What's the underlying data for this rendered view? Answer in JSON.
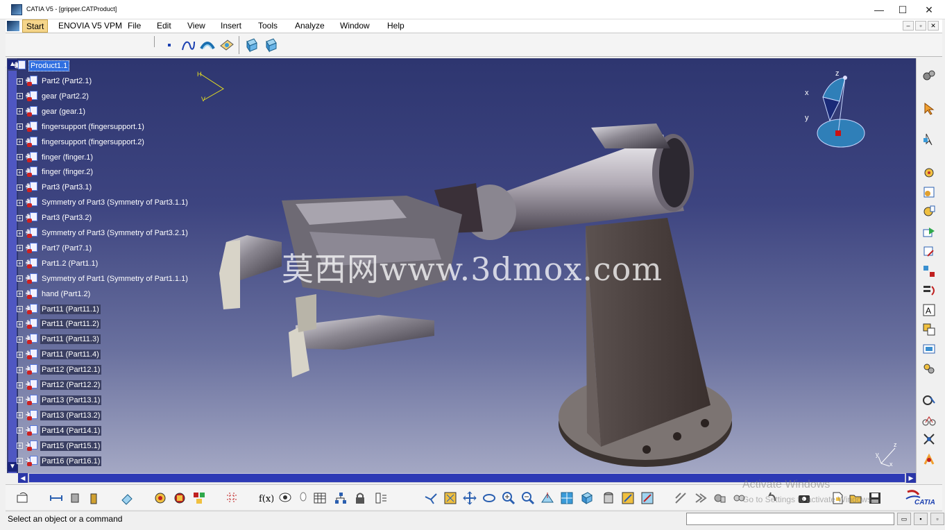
{
  "window": {
    "title": "CATIA V5 - [gripper.CATProduct]",
    "controls": {
      "minimize": "—",
      "maximize": "☐",
      "close": "✕"
    }
  },
  "menu": {
    "items": [
      "Start",
      "ENOVIA V5 VPM",
      "File",
      "Edit",
      "View",
      "Insert",
      "Tools",
      "Analyze",
      "Window",
      "Help"
    ],
    "mdi_controls": [
      "–",
      "▫",
      "✕"
    ]
  },
  "tree": {
    "root": "Product1.1",
    "items": [
      "Part2 (Part2.1)",
      "gear (Part2.2)",
      "gear (gear.1)",
      "fingersupport (fingersupport.1)",
      "fingersupport (fingersupport.2)",
      "finger (finger.1)",
      "finger (finger.2)",
      "Part3 (Part3.1)",
      "Symmetry of Part3 (Symmetry of Part3.1.1)",
      "Part3 (Part3.2)",
      "Symmetry of Part3 (Symmetry of Part3.2.1)",
      "Part7 (Part7.1)",
      "Part1.2 (Part1.1)",
      "Symmetry of Part1 (Symmetry of Part1.1.1)",
      "hand (Part1.2)",
      "Part11 (Part11.1)",
      "Part11 (Part11.2)",
      "Part11 (Part11.3)",
      "Part11 (Part11.4)",
      "Part12 (Part12.1)",
      "Part12 (Part12.2)",
      "Part13 (Part13.1)",
      "Part13 (Part13.2)",
      "Part14 (Part14.1)",
      "Part15 (Part15.1)",
      "Part16 (Part16.1)"
    ]
  },
  "viewport": {
    "watermark": "莫西网www.3dmox.com",
    "compass": {
      "x": "x",
      "y": "y",
      "z": "z"
    },
    "axis_labels": {
      "h": "H",
      "v": "V",
      "x": "x",
      "y": "y",
      "z": "z"
    }
  },
  "os_notice": {
    "title": "Activate Windows",
    "subtitle": "Go to Settings to activate Windows."
  },
  "status": {
    "message": "Select an object or a command",
    "command_value": ""
  },
  "brand": {
    "logo_text": "CATIA"
  },
  "colors": {
    "viewport_top": "#2e3670",
    "viewport_bottom": "#a4a8c4",
    "selection": "#2f6ee0",
    "start_menu": "#f5d58a"
  }
}
